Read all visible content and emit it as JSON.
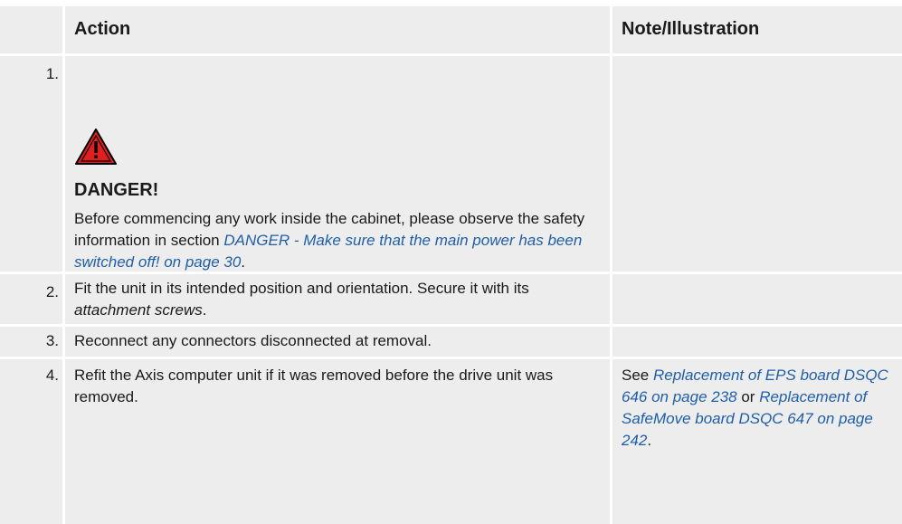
{
  "header": {
    "action": "Action",
    "note": "Note/Illustration"
  },
  "steps": [
    {
      "num": "1.",
      "danger_title": "DANGER!",
      "text_a": "Before commencing any work inside the cabinet, please observe the safety information in section ",
      "link": "DANGER - Make sure that the main power has been switched off! on page 30",
      "text_b": "."
    },
    {
      "num": "2.",
      "text_a": "Fit the unit in its intended position and orientation. Secure it with its ",
      "italic": "attachment screws",
      "text_b": "."
    },
    {
      "num": "3.",
      "text_a": "Reconnect any connectors disconnected at removal."
    },
    {
      "num": "4.",
      "text_a": "Refit the Axis computer unit if it was removed before the drive unit was removed.",
      "note_a": "See ",
      "note_link1": "Replacement of EPS board DSQC 646 on page 238",
      "note_mid": " or ",
      "note_link2": "Replacement of SafeMove board DSQC 647 on page 242",
      "note_b": "."
    }
  ],
  "icon": {
    "name": "warning-icon",
    "fill": "#e02020",
    "stroke": "#000000"
  },
  "colors": {
    "cell_bg": "#ededed",
    "link": "#1f5fa8"
  }
}
